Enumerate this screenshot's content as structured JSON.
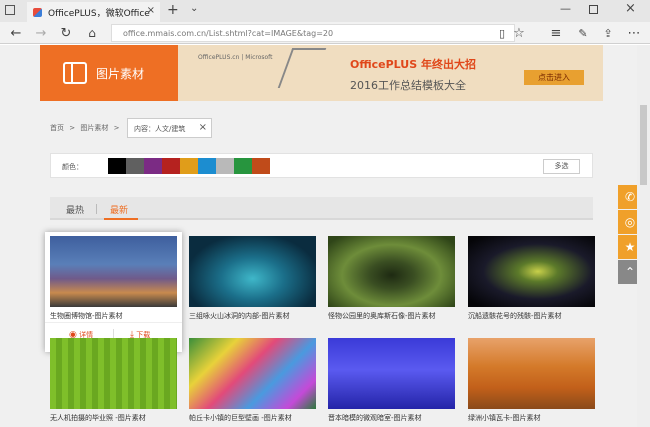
{
  "browser": {
    "tab_title": "OfficePLUS，微软Office",
    "new_tab": "+",
    "address": "office.mmais.com.cn/List.shtml?cat=IMAGE&tag=20"
  },
  "banner": {
    "section_title": "图片素材",
    "ad_brand": "OfficePLUS.cn | Microsoft",
    "ad_headline": "OfficePLUS 年终出大招",
    "ad_subline": "2016工作总结模板大全",
    "ad_button": "点击进入"
  },
  "breadcrumb": {
    "home": "首页",
    "sep1": ">",
    "images": "图片素材",
    "sep2": ">",
    "filter_tag": "内容：人文/建筑",
    "filter_close": "×"
  },
  "color_filter": {
    "label": "颜色：",
    "multi_select": "多选",
    "swatches": [
      "#000000",
      "#606060",
      "#7b2b84",
      "#b5221f",
      "#e09d1a",
      "#1c8dd0",
      "#b9b9b9",
      "#27953e",
      "#c04b1a"
    ]
  },
  "sort_tabs": {
    "hot": "最热",
    "newest": "最新"
  },
  "hover_actions": {
    "details": "详情",
    "download": "下载"
  },
  "cards": [
    {
      "caption": "生物圈博物馆-图片素材"
    },
    {
      "caption": "三组咏火山冰洞的内部-图片素材"
    },
    {
      "caption": "怪物公园里的奥库斯石像-图片素材"
    },
    {
      "caption": "沉船遗骸花号的残骸-图片素材"
    },
    {
      "caption": "无人机拍摄的毕业照 -图片素材"
    },
    {
      "caption": "帕丘卡小镇的巨型壁画 -图片素材"
    },
    {
      "caption": "晋本暗模的微观暗室-图片素材"
    },
    {
      "caption": "绿洲小镇瓦卡-图片素材"
    }
  ],
  "accent": "#ee6f24"
}
